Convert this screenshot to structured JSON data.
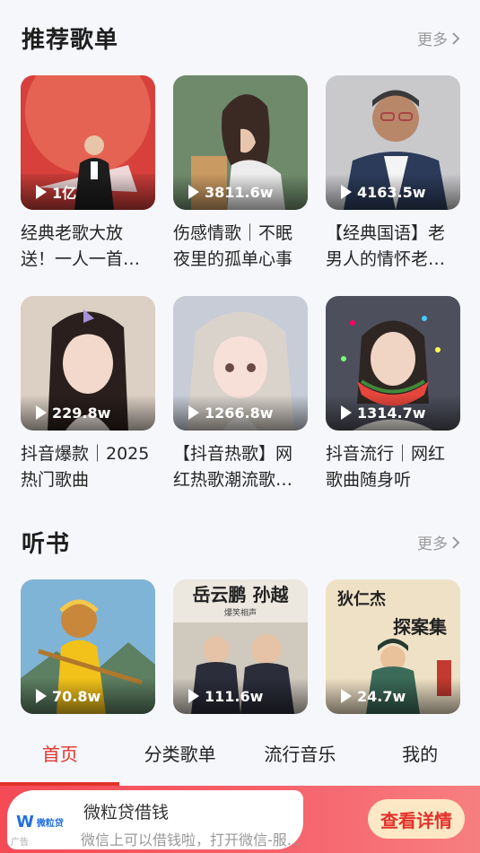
{
  "playlist_section": {
    "title": "推荐歌单",
    "more_label": "更多",
    "cards": [
      {
        "play_count": "1亿",
        "title": "经典老歌大放送！一人一首…"
      },
      {
        "play_count": "3811.6w",
        "title": "伤感情歌｜不眠夜里的孤单心事"
      },
      {
        "play_count": "4163.5w",
        "title": "【经典国语】老男人的情怀老…"
      },
      {
        "play_count": "229.8w",
        "title": "抖音爆款｜2025热门歌曲"
      },
      {
        "play_count": "1266.8w",
        "title": "【抖音热歌】网红热歌潮流歌…"
      },
      {
        "play_count": "1314.7w",
        "title": "抖音流行｜网红歌曲随身听"
      }
    ]
  },
  "audiobook_section": {
    "title": "听书",
    "more_label": "更多",
    "cards": [
      {
        "play_count": "70.8w"
      },
      {
        "play_count": "111.6w",
        "cover_text_1": "岳云鹏 孙越",
        "cover_text_2": "爆笑相声"
      },
      {
        "play_count": "24.7w",
        "cover_text_1": "狄仁杰",
        "cover_text_2": "探案集"
      }
    ]
  },
  "tabbar": {
    "tabs": [
      "首页",
      "分类歌单",
      "流行音乐",
      "我的"
    ],
    "active_index": 0,
    "active_color": "#e2322b"
  },
  "ad": {
    "logo_mark": "W",
    "logo_name": "微粒贷",
    "tag": "广告",
    "title": "微粒贷借钱",
    "subtitle": "微信上可以借钱啦，打开微信-服…",
    "button": "查看详情"
  }
}
